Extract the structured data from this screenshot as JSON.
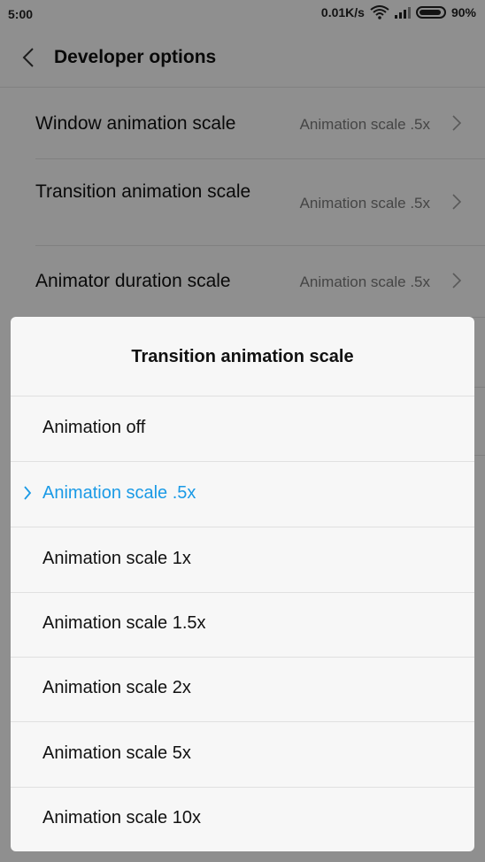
{
  "status_bar": {
    "time": "5:00",
    "speed": "0.01K/s",
    "battery_percent": "90%"
  },
  "header": {
    "title": "Developer options"
  },
  "settings": [
    {
      "label": "Window animation scale",
      "value": "Animation scale .5x"
    },
    {
      "label": "Transition animation scale",
      "value": "Animation scale .5x"
    },
    {
      "label": "Animator duration scale",
      "value": "Animation scale .5x"
    }
  ],
  "dialog": {
    "title": "Transition animation scale",
    "selected_index": 1,
    "selected_color": "#1a9ae6",
    "options": [
      "Animation off",
      "Animation scale .5x",
      "Animation scale 1x",
      "Animation scale 1.5x",
      "Animation scale 2x",
      "Animation scale 5x",
      "Animation scale 10x"
    ]
  },
  "icons": {
    "back": "chevron-left-icon",
    "row_arrow": "chevron-right-icon",
    "selected_mark": "chevron-right-icon"
  }
}
